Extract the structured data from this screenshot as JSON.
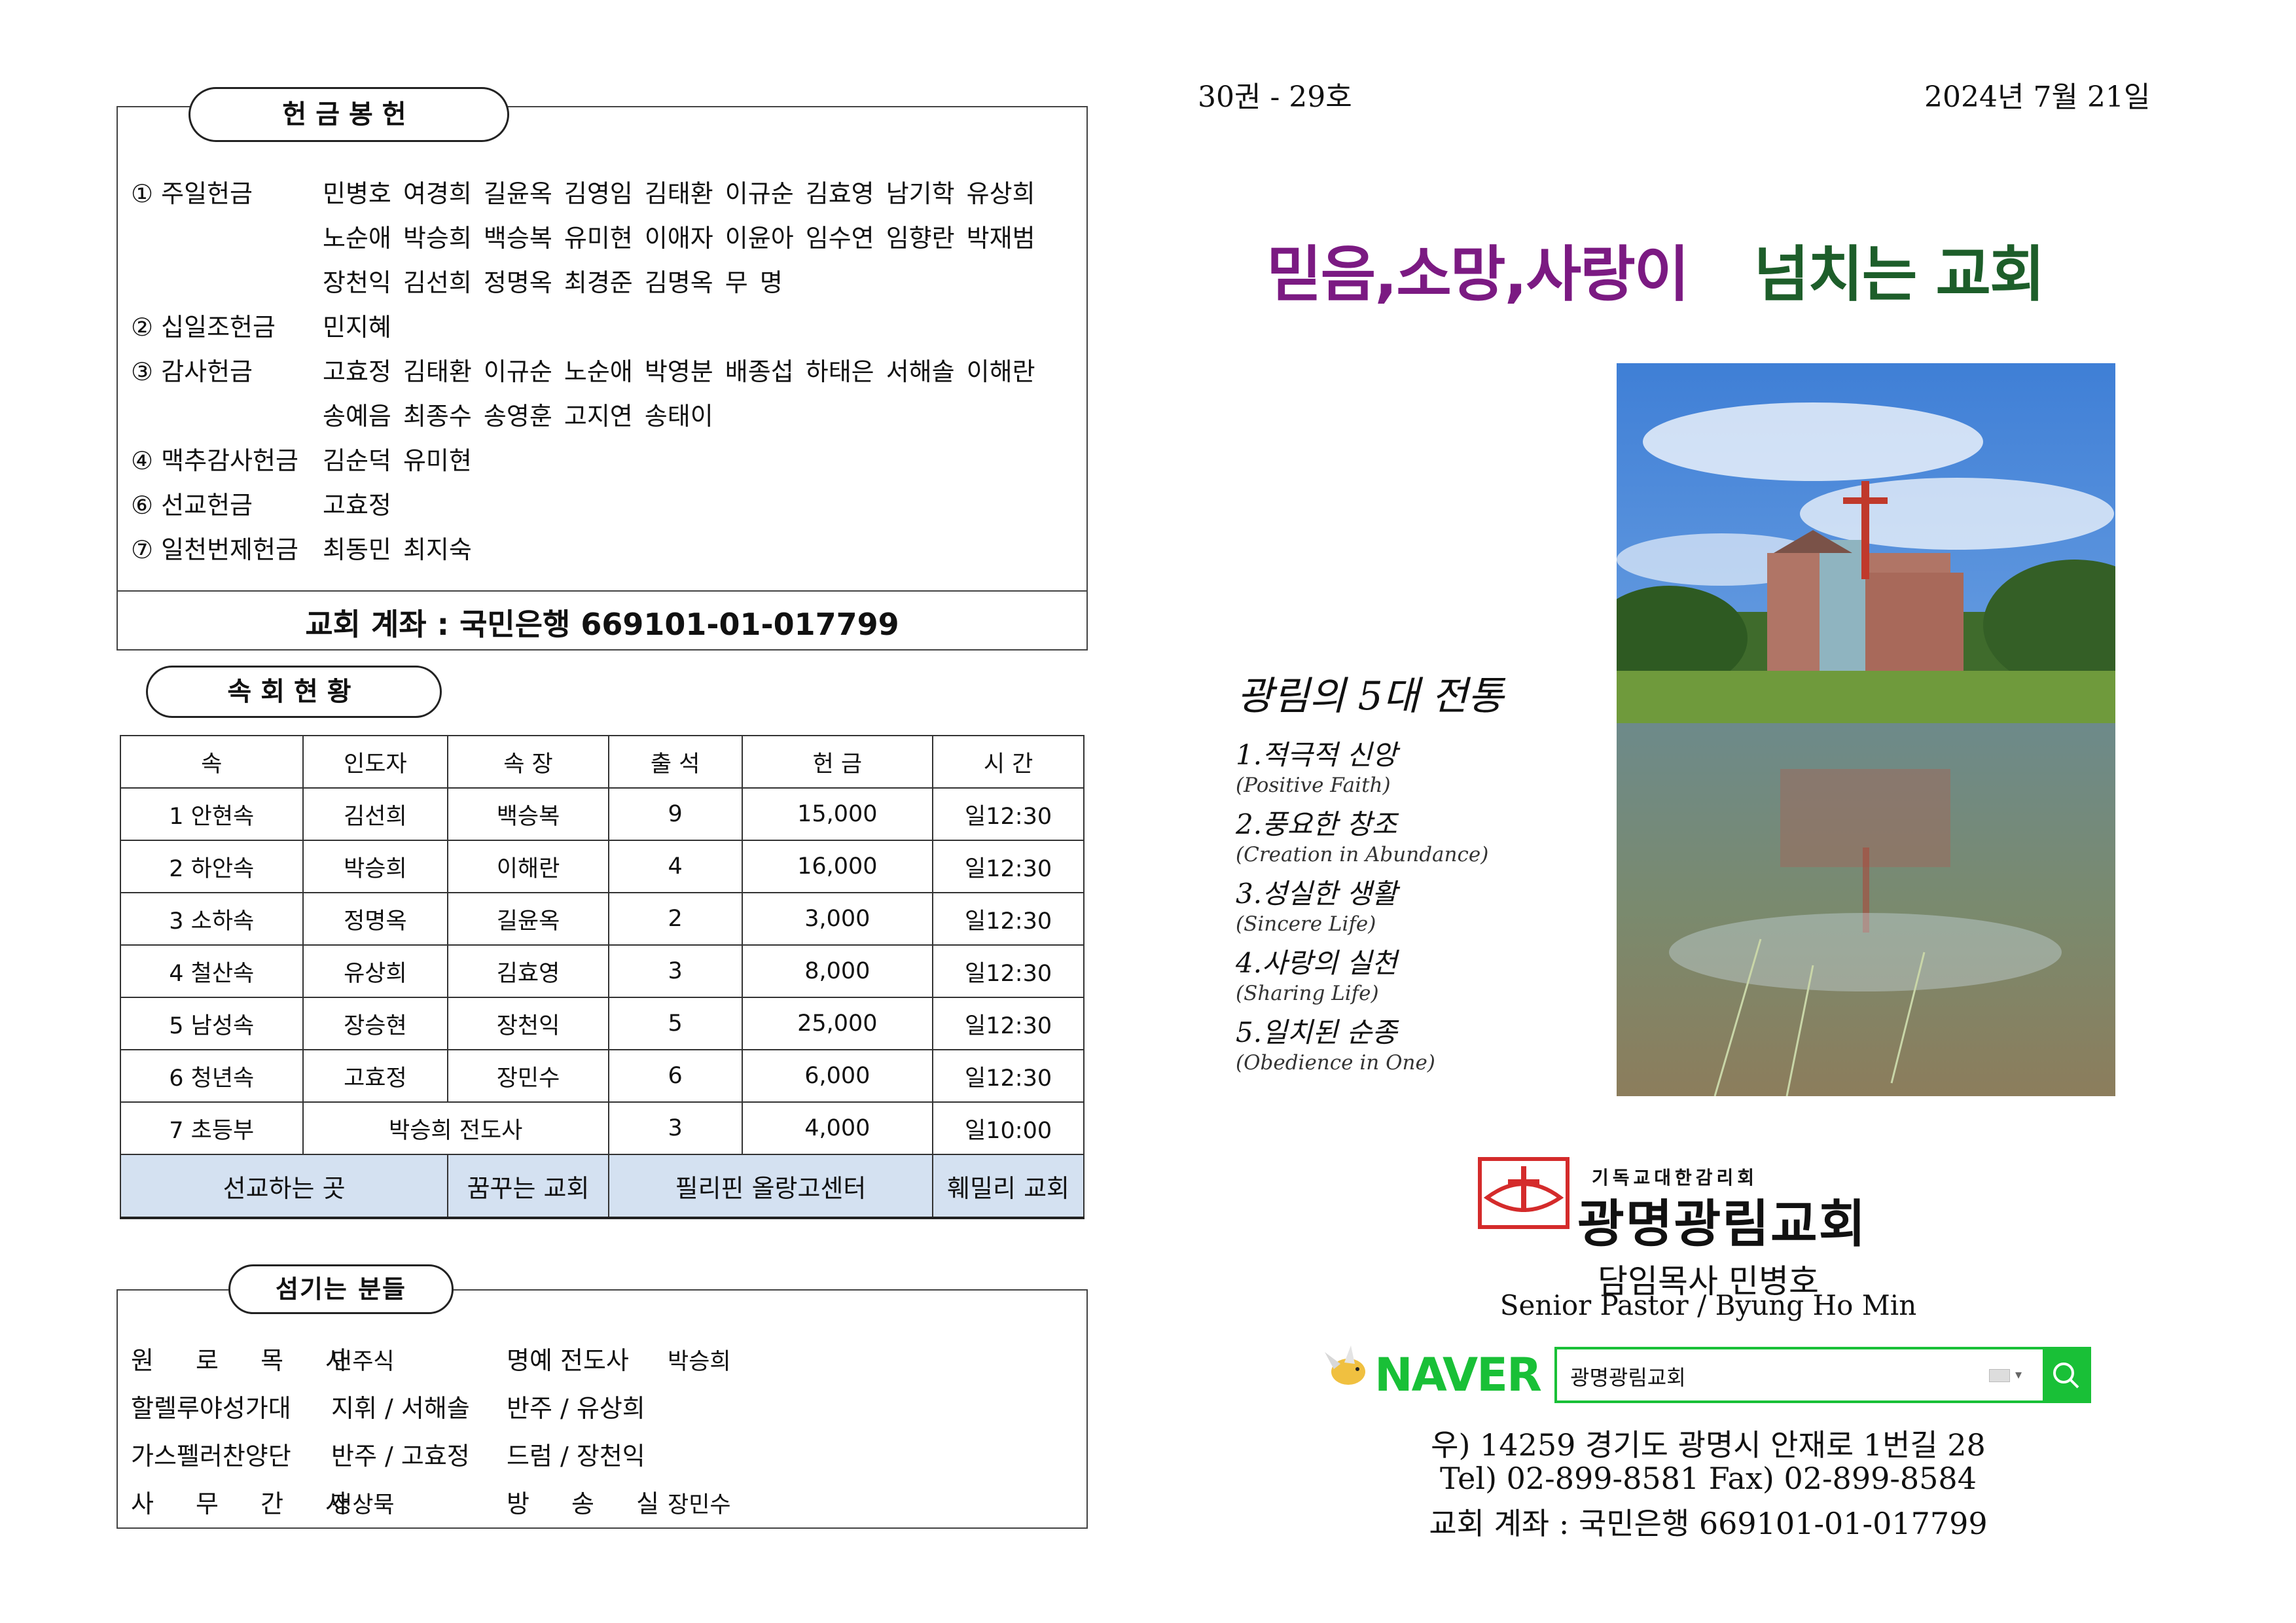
{
  "offering": {
    "title": "헌금봉헌",
    "rows": [
      {
        "label": "① 주일헌금",
        "lines": [
          "민병호 여경희 길윤옥 김영임 김태환 이규순 김효영 남기학 유상희",
          "노순애 박승희 백승복 유미현 이애자 이윤아 임수연 임향란 박재범",
          "장천익 김선희 정명옥 최경준 김명옥 무 명"
        ]
      },
      {
        "label": "② 십일조헌금",
        "lines": [
          "민지혜"
        ]
      },
      {
        "label": "③ 감사헌금",
        "lines": [
          "고효정 김태환 이규순 노순애 박영분 배종섭 하태은 서해솔 이해란",
          "송예음 최종수 송영훈 고지연 송태이"
        ]
      },
      {
        "label": "④ 맥추감사헌금",
        "lines": [
          "김순덕 유미현"
        ]
      },
      {
        "label": "⑥ 선교헌금",
        "lines": [
          "고효정"
        ]
      },
      {
        "label": "⑦ 일천번제헌금",
        "lines": [
          "최동민 최지숙"
        ]
      }
    ],
    "account": "교회 계좌 : 국민은행 669101-01-017799"
  },
  "groups": {
    "title": "속회현황",
    "headers": [
      "속",
      "인도자",
      "속 장",
      "출 석",
      "헌 금",
      "시 간"
    ],
    "rows": [
      [
        "1 안현속",
        "김선희",
        "백승복",
        "9",
        "15,000",
        "일12:30"
      ],
      [
        "2 하안속",
        "박승희",
        "이해란",
        "4",
        "16,000",
        "일12:30"
      ],
      [
        "3 소하속",
        "정명옥",
        "길윤옥",
        "2",
        "3,000",
        "일12:30"
      ],
      [
        "4 철산속",
        "유상희",
        "김효영",
        "3",
        "8,000",
        "일12:30"
      ],
      [
        "5 남성속",
        "장승현",
        "장천익",
        "5",
        "25,000",
        "일12:30"
      ],
      [
        "6 청년속",
        "고효정",
        "장민수",
        "6",
        "6,000",
        "일12:30"
      ]
    ],
    "last_row": {
      "name": "7 초등부",
      "leader": "박승희 전도사",
      "attendance": "3",
      "offering": "4,000",
      "time": "일10:00"
    },
    "mission": {
      "label": "선교하는 곳",
      "places": [
        "꿈꾸는 교회",
        "필리핀 올랑고센터",
        "훼밀리 교회"
      ]
    }
  },
  "servers": {
    "title": "섬기는 분들",
    "rows": [
      {
        "l1": "원 로 목 사",
        "v1": "민주식",
        "l2": "명예 전도사",
        "v2": "박승희"
      },
      {
        "l1": "할렐루야성가대",
        "v1": "지휘 / 서해솔",
        "l2": "반주 / 유상희",
        "v2": ""
      },
      {
        "l1": "가스펠러찬양단",
        "v1": "반주 / 고효정",
        "l2": "드럼 / 장천익",
        "v2": ""
      },
      {
        "l1": "사 무 간 사",
        "v1": "정상묵",
        "l2": "방 송 실",
        "v2": "장민수"
      }
    ]
  },
  "cover": {
    "volume": "30권 - 29호",
    "date": "2024년 7월 21일",
    "slogan_part1": "믿음,소망,사랑이",
    "slogan_part2": "넘치는 교회",
    "traditions_title": "광림의 5대 전통",
    "traditions": [
      {
        "ko": "1.적극적 신앙",
        "en": "(Positive Faith)"
      },
      {
        "ko": "2.풍요한 창조",
        "en": "(Creation in Abundance)"
      },
      {
        "ko": "3.성실한 생활",
        "en": "(Sincere Life)"
      },
      {
        "ko": "4.사랑의 실천",
        "en": "(Sharing Life)"
      },
      {
        "ko": "5.일치된 순종",
        "en": "(Obedience in One)"
      }
    ],
    "denomination": "기독교대한감리회",
    "church_name": "광명광림교회",
    "pastor_ko": "담임목사 민병호",
    "pastor_en": "Senior Pastor / Byung Ho Min",
    "search_brand": "NAVER",
    "search_value": "광명광림교회",
    "address": "우) 14259 경기도 광명시 안재로 1번길 28",
    "phone": "Tel) 02-899-8581 Fax) 02-899-8584",
    "account": "교회 계좌 : 국민은행 669101-01-017799"
  },
  "colors": {
    "slogan_purple": "#7b1a82",
    "slogan_green": "#1d5e2a",
    "naver_green": "#19c037",
    "logo_red": "#d42b2b",
    "mission_blue": "#d4e1f1"
  }
}
